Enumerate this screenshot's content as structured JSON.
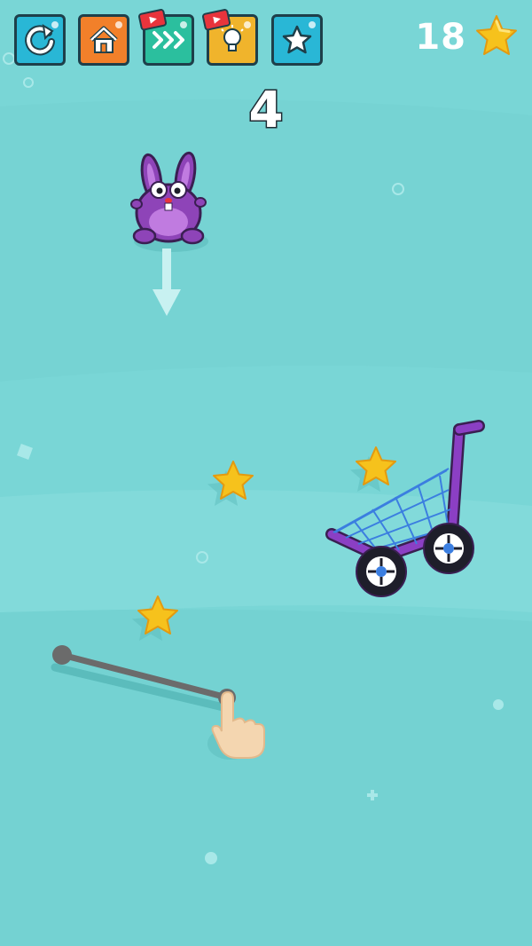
{
  "toolbar": {
    "buttons": [
      {
        "name": "restart",
        "icon": "restart-icon",
        "color": "#29b7d6"
      },
      {
        "name": "home",
        "icon": "home-icon",
        "color": "#f2802a"
      },
      {
        "name": "skip",
        "icon": "skip-level-icon",
        "color": "#2bbf9e",
        "ad": true
      },
      {
        "name": "hint",
        "icon": "lightbulb-icon",
        "color": "#f0b42c",
        "ad": true
      },
      {
        "name": "shop",
        "icon": "star-icon",
        "color": "#29b7d6"
      }
    ]
  },
  "score": {
    "value": "18",
    "icon": "star-icon"
  },
  "level": {
    "number": "4"
  },
  "colors": {
    "background": "#79d6d6",
    "bunny": "#8e44b8",
    "cart": "#8b3fc4",
    "star": "#f6c21c"
  }
}
